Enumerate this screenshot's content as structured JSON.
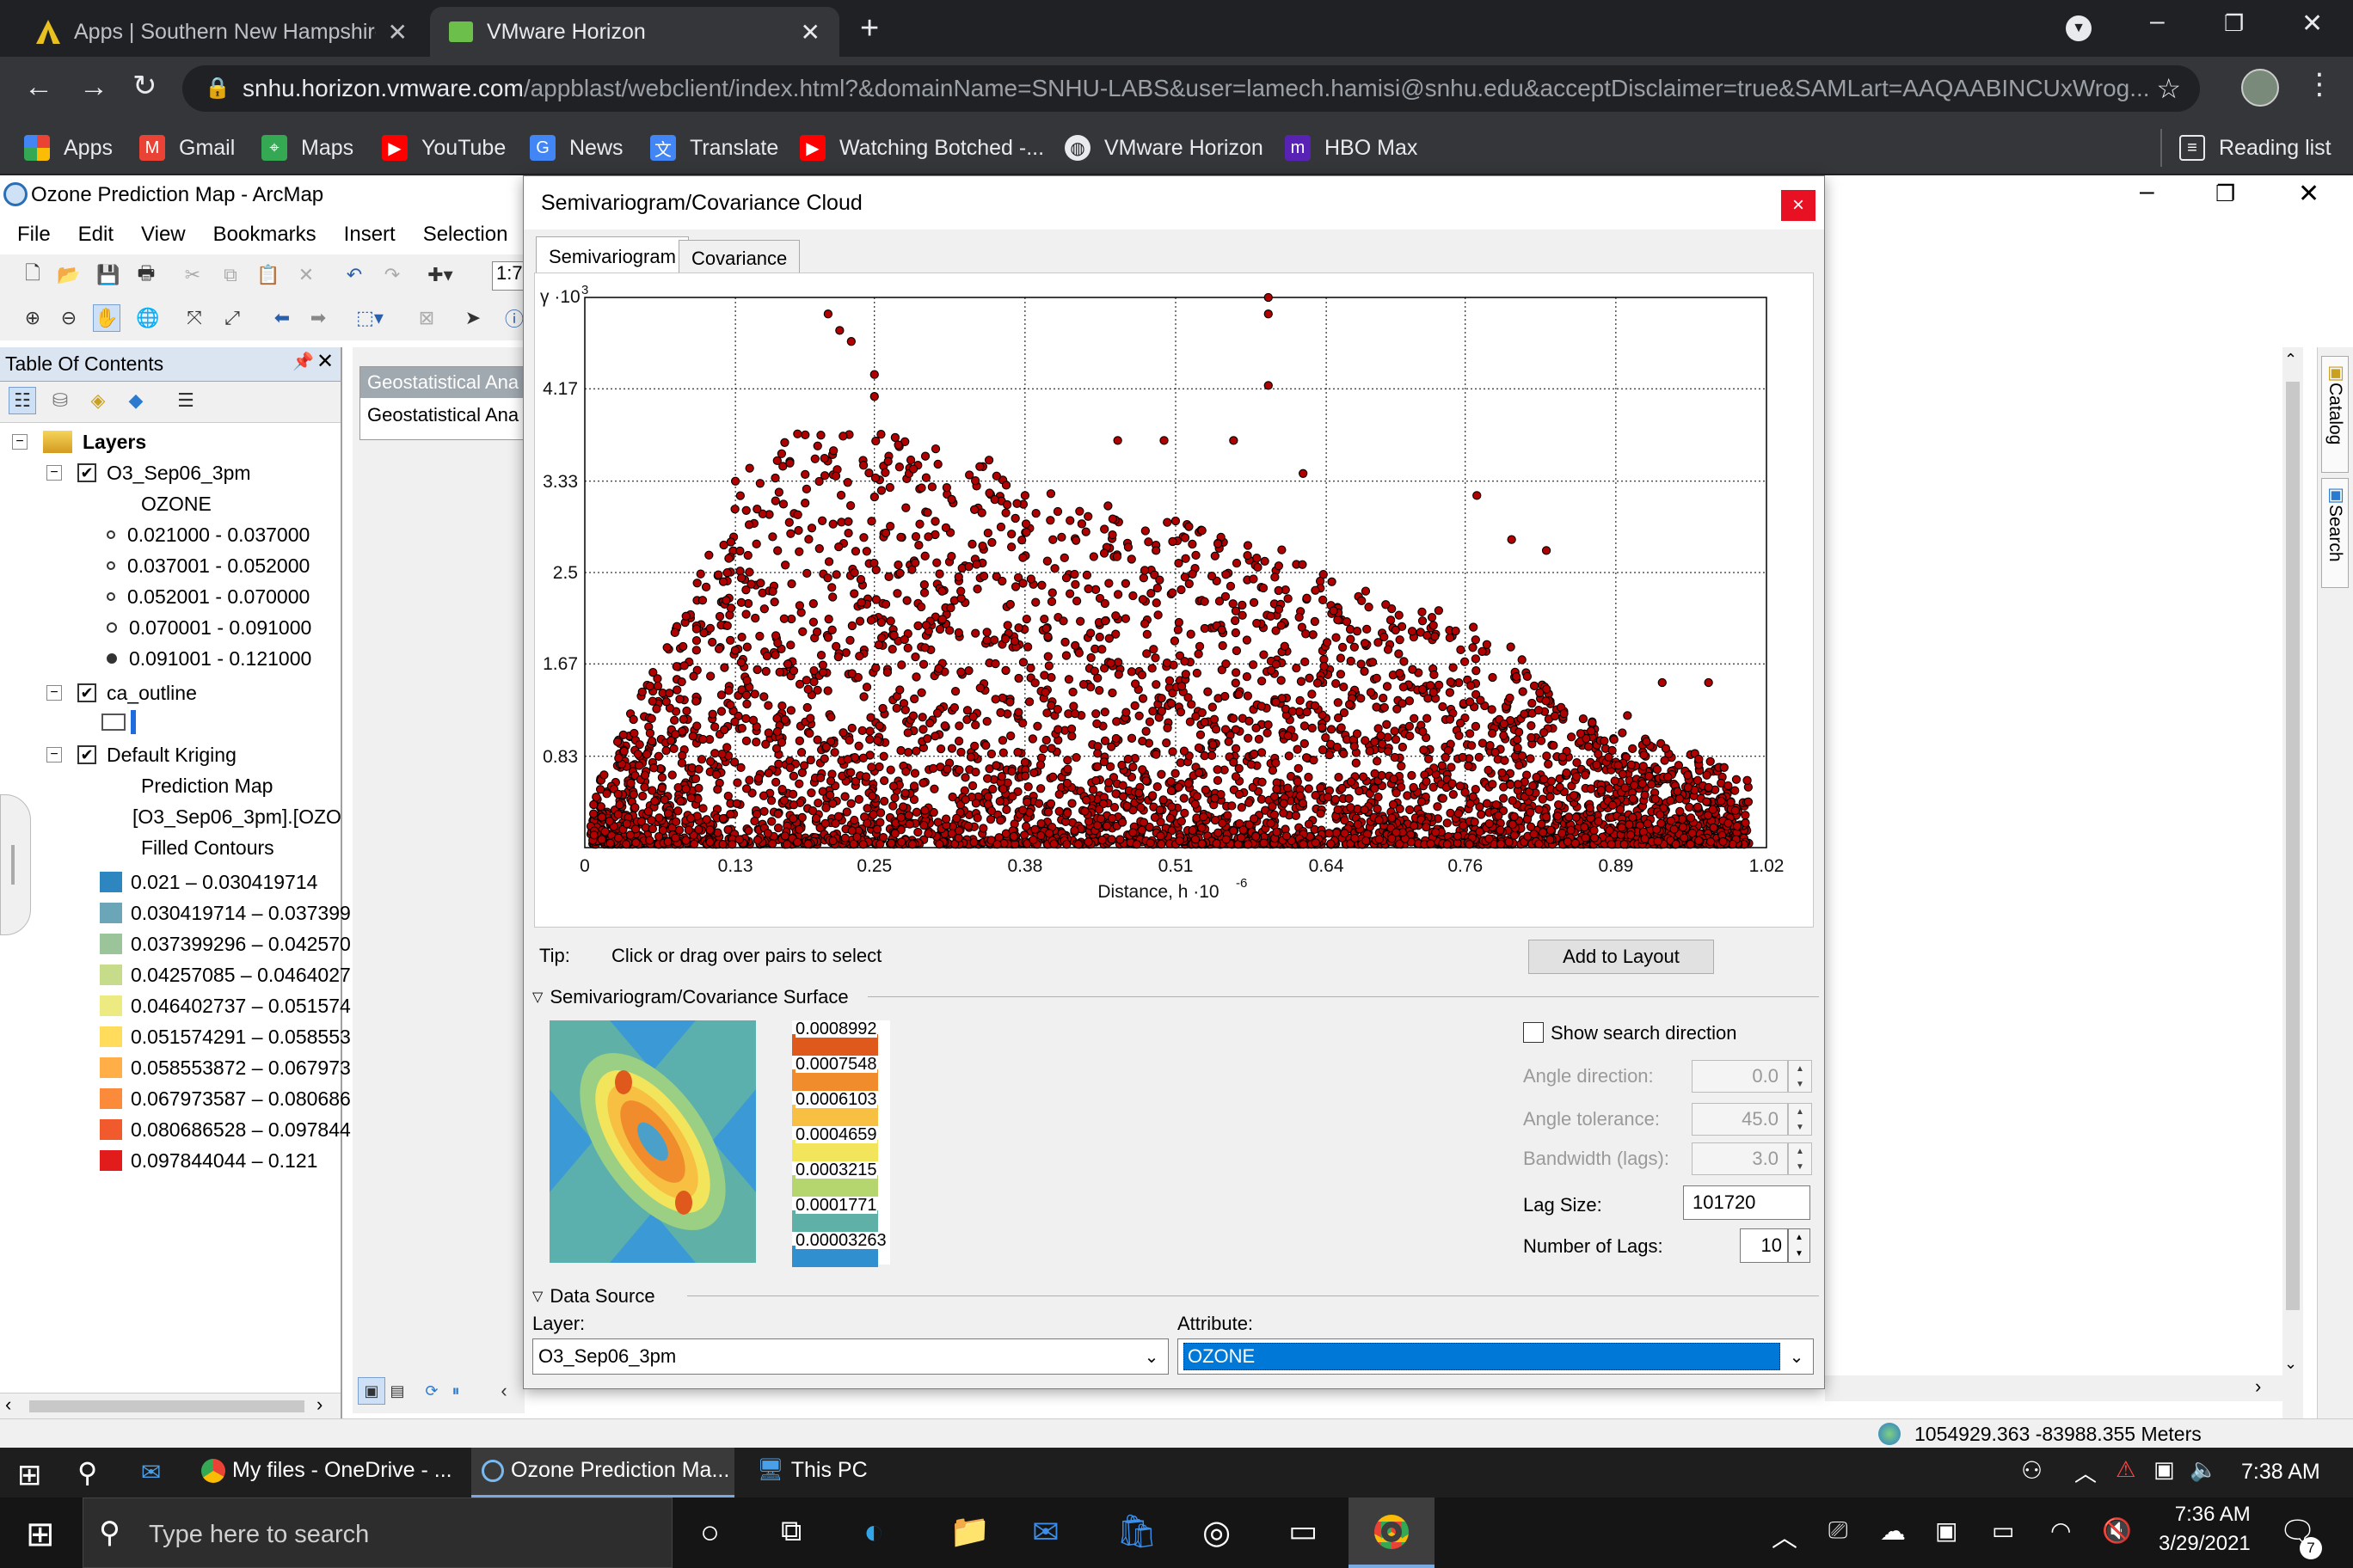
{
  "browser": {
    "tabs": [
      {
        "title": "Apps | Southern New Hampshire",
        "active": false
      },
      {
        "title": "VMware Horizon",
        "active": true
      }
    ],
    "url_host": "snhu.horizon.vmware.com",
    "url_path": "/appblast/webclient/index.html?&domainName=SNHU-LABS&user=lamech.hamisi@snhu.edu&acceptDisclaimer=true&SAMLart=AAQAABINCUxWrog...",
    "bookmarks": [
      "Apps",
      "Gmail",
      "Maps",
      "YouTube",
      "News",
      "Translate",
      "Watching Botched -...",
      "VMware Horizon",
      "HBO Max"
    ],
    "reading_list": "Reading list"
  },
  "arcmap": {
    "title": "Ozone Prediction Map - ArcMap",
    "menu": [
      "File",
      "Edit",
      "View",
      "Bookmarks",
      "Insert",
      "Selection"
    ],
    "scale_box": "1:7",
    "toc": {
      "header": "Table Of Contents",
      "layers_root": "Layers",
      "layer1": {
        "name": "O3_Sep06_3pm",
        "field": "OZONE",
        "classes": [
          "0.021000 - 0.037000",
          "0.037001 - 0.052000",
          "0.052001 - 0.070000",
          "0.070001 - 0.091000",
          "0.091001 - 0.121000"
        ]
      },
      "layer2": {
        "name": "ca_outline"
      },
      "layer3": {
        "name": "Default Kriging",
        "sub1": "Prediction Map",
        "sub2": "[O3_Sep06_3pm].[OZO",
        "sub3": "Filled Contours",
        "classes": [
          {
            "label": "0.021 – 0.030419714",
            "color": "#2e86c1"
          },
          {
            "label": "0.030419714 – 0.037399",
            "color": "#6aa5b8"
          },
          {
            "label": "0.037399296 – 0.042570",
            "color": "#9cc49a"
          },
          {
            "label": "0.04257085 – 0.0464027",
            "color": "#c7dc8a"
          },
          {
            "label": "0.046402737 – 0.051574",
            "color": "#eeea82"
          },
          {
            "label": "0.051574291 – 0.058553",
            "color": "#ffdc5c"
          },
          {
            "label": "0.058553872 – 0.067973",
            "color": "#ffae48"
          },
          {
            "label": "0.067973587 – 0.080686",
            "color": "#fb8a3a"
          },
          {
            "label": "0.080686528 – 0.097844",
            "color": "#f05a2c"
          },
          {
            "label": "0.097844044 – 0.121",
            "color": "#e21b1b"
          }
        ]
      }
    },
    "ga_toolbar": [
      "Geostatistical Ana",
      "Geostatistical Ana"
    ],
    "status_coords": "1054929.363  -83988.355 Meters"
  },
  "dialog": {
    "title": "Semivariogram/Covariance Cloud",
    "close": "×",
    "tabs": [
      "Semivariogram",
      "Covariance"
    ],
    "tip_label": "Tip:",
    "tip_text": "Click or drag over pairs to select",
    "add_to_layout": "Add to Layout",
    "surface_section": "Semivariogram/Covariance Surface",
    "surface_legend": [
      "0.0008992",
      "0.0007548",
      "0.0006103",
      "0.0004659",
      "0.0003215",
      "0.0001771",
      "0.00003263"
    ],
    "surface_legend_colors": [
      "#e0591c",
      "#f08c2c",
      "#f7c042",
      "#f2e55c",
      "#b5d56e",
      "#5fb1a7",
      "#2f8fcf"
    ],
    "show_search_direction": "Show search direction",
    "show_search_direction_checked": false,
    "angle_direction_label": "Angle direction:",
    "angle_direction": "0.0",
    "angle_tolerance_label": "Angle tolerance:",
    "angle_tolerance": "45.0",
    "bandwidth_label": "Bandwidth (lags):",
    "bandwidth": "3.0",
    "lag_size_label": "Lag Size:",
    "lag_size": "101720",
    "num_lags_label": "Number of Lags:",
    "num_lags": "10",
    "data_source_section": "Data Source",
    "layer_label": "Layer:",
    "layer_value": "O3_Sep06_3pm",
    "attribute_label": "Attribute:",
    "attribute_value": "OZONE"
  },
  "chart_data": {
    "type": "scatter",
    "ylabel_prefix": "γ ·10",
    "ylabel_exp": "3",
    "xlabel": "Distance, h ·10",
    "xlabel_exp": "-6",
    "x_ticks": [
      "0",
      "0.13",
      "0.25",
      "0.38",
      "0.51",
      "0.64",
      "0.76",
      "0.89",
      "1.02"
    ],
    "y_ticks": [
      "0.83",
      "1.67",
      "2.5",
      "3.33",
      "4.17"
    ],
    "xlim": [
      0,
      1.02
    ],
    "ylim": [
      0,
      5.0
    ],
    "grid": true,
    "point_color": "#b00000",
    "description_points": "dense cloud of several thousand empirical semivariogram pairs; highest pairs near x=0.59, y≈5.0; envelope rises from ~0.4 at x=0 to ~3–4 for x=0.15–0.6, then falls to ~1 at x=1.0",
    "envelope": [
      [
        0.0,
        0.4
      ],
      [
        0.05,
        1.4
      ],
      [
        0.1,
        2.6
      ],
      [
        0.15,
        3.6
      ],
      [
        0.2,
        3.8
      ],
      [
        0.25,
        3.8
      ],
      [
        0.3,
        3.6
      ],
      [
        0.35,
        3.5
      ],
      [
        0.4,
        3.2
      ],
      [
        0.45,
        3.1
      ],
      [
        0.5,
        3.0
      ],
      [
        0.55,
        2.8
      ],
      [
        0.6,
        2.7
      ],
      [
        0.65,
        2.4
      ],
      [
        0.7,
        2.2
      ],
      [
        0.75,
        2.1
      ],
      [
        0.8,
        1.8
      ],
      [
        0.85,
        1.2
      ],
      [
        0.9,
        1.0
      ],
      [
        0.95,
        0.9
      ],
      [
        1.0,
        0.6
      ]
    ],
    "outliers": [
      [
        0.13,
        3.33
      ],
      [
        0.21,
        4.85
      ],
      [
        0.22,
        4.7
      ],
      [
        0.23,
        4.6
      ],
      [
        0.25,
        4.3
      ],
      [
        0.25,
        4.1
      ],
      [
        0.59,
        5.0
      ],
      [
        0.59,
        4.85
      ],
      [
        0.59,
        4.2
      ],
      [
        0.56,
        3.7
      ],
      [
        0.62,
        3.4
      ],
      [
        0.46,
        3.7
      ],
      [
        0.5,
        3.7
      ],
      [
        0.38,
        3.2
      ],
      [
        0.77,
        3.2
      ],
      [
        0.8,
        2.8
      ],
      [
        0.83,
        2.7
      ],
      [
        0.97,
        1.5
      ],
      [
        0.93,
        1.5
      ],
      [
        0.9,
        1.2
      ]
    ]
  },
  "taskbar": {
    "apps": [
      "My files - OneDrive - ...",
      "Ozone Prediction Ma...",
      "This PC"
    ],
    "vm_time": "7:38 AM",
    "search_placeholder": "Type here to search",
    "time": "7:36 AM",
    "date": "3/29/2021",
    "notif_count": "7"
  }
}
